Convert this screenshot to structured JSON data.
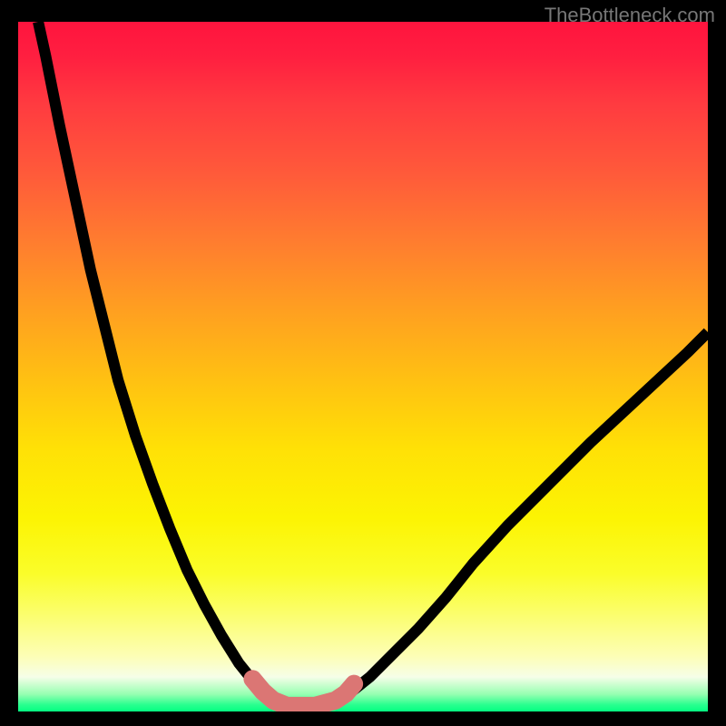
{
  "watermark": "TheBottleneck.com",
  "chart_data": {
    "type": "line",
    "title": "",
    "xlabel": "",
    "ylabel": "",
    "xlim": [
      0,
      100
    ],
    "ylim": [
      0,
      100
    ],
    "series": [
      {
        "name": "bottleneck-curve",
        "x": [
          2.9,
          4.0,
          5.0,
          6.0,
          7.5,
          9.0,
          10.5,
          12.5,
          14.5,
          17.0,
          19.5,
          22.0,
          24.5,
          27.0,
          29.5,
          32.0,
          34.0,
          35.5,
          37.0,
          38.5,
          40.0,
          42.0,
          44.0,
          46.0,
          48.5,
          51.0,
          54.0,
          58.0,
          62.0,
          66.0,
          71.0,
          77.0,
          83.0,
          90.0,
          97.0,
          100.0
        ],
        "values": [
          100.0,
          95.0,
          90.0,
          85.0,
          78.0,
          71.0,
          64.0,
          56.0,
          48.0,
          40.0,
          33.0,
          26.5,
          20.5,
          15.5,
          11.0,
          7.0,
          4.5,
          2.8,
          1.6,
          0.8,
          0.5,
          0.6,
          1.0,
          1.8,
          3.0,
          5.0,
          8.0,
          12.0,
          16.5,
          21.5,
          27.0,
          33.0,
          39.0,
          45.5,
          52.0,
          55.0
        ]
      }
    ],
    "overlay": {
      "name": "highlight-segment",
      "x": [
        34.0,
        35.5,
        37.0,
        39.0,
        43.0,
        46.0,
        47.5,
        48.7
      ],
      "values": [
        4.7,
        2.9,
        1.6,
        0.8,
        0.8,
        1.6,
        2.6,
        4.0
      ],
      "color": "#db7674"
    }
  }
}
